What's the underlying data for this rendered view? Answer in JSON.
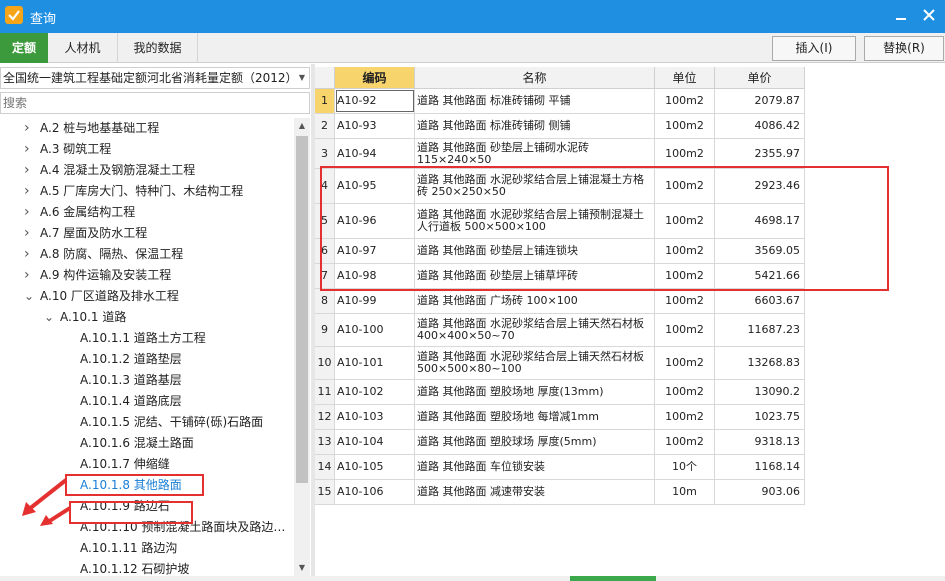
{
  "window": {
    "title": "查询"
  },
  "tabs": [
    {
      "label": "定额"
    },
    {
      "label": "人材机"
    },
    {
      "label": "我的数据"
    }
  ],
  "toolbar": {
    "insert_label": "插入(I)",
    "replace_label": "替换(R)"
  },
  "quota_select": {
    "value": "全国统一建筑工程基础定额河北省消耗量定额（2012）"
  },
  "search": {
    "placeholder": "搜索"
  },
  "tree": [
    {
      "label": "A.2 桩与地基基础工程",
      "expanded": false
    },
    {
      "label": "A.3 砌筑工程",
      "expanded": false
    },
    {
      "label": "A.4 混凝土及钢筋混凝土工程",
      "expanded": false
    },
    {
      "label": "A.5 厂库房大门、特种门、木结构工程",
      "expanded": false
    },
    {
      "label": "A.6 金属结构工程",
      "expanded": false
    },
    {
      "label": "A.7 屋面及防水工程",
      "expanded": false
    },
    {
      "label": "A.8 防腐、隔热、保温工程",
      "expanded": false
    },
    {
      "label": "A.9 构件运输及安装工程",
      "expanded": false
    },
    {
      "label": "A.10 厂区道路及排水工程",
      "expanded": true
    },
    {
      "label": "A.10.1 道路",
      "expanded": true
    },
    {
      "label": "A.10.1.1 道路土方工程"
    },
    {
      "label": "A.10.1.2 道路垫层"
    },
    {
      "label": "A.10.1.3 道路基层"
    },
    {
      "label": "A.10.1.4 道路底层"
    },
    {
      "label": "A.10.1.5 泥结、干铺碎(砾)石路面"
    },
    {
      "label": "A.10.1.6 混凝土路面"
    },
    {
      "label": "A.10.1.7 伸缩缝"
    },
    {
      "label": "A.10.1.8 其他路面",
      "selected": true
    },
    {
      "label": "A.10.1.9 路边石"
    },
    {
      "label": "A.10.1.10 预制混凝土路面块及路边…"
    },
    {
      "label": "A.10.1.11 路边沟"
    },
    {
      "label": "A.10.1.12 石砌护坡"
    }
  ],
  "table": {
    "headers": {
      "code": "编码",
      "name": "名称",
      "unit": "单位",
      "price": "单价"
    },
    "rows": [
      {
        "idx": "1",
        "code": "A10-92",
        "name": "道路 其他路面 标准砖铺砌 平铺",
        "unit": "100m2",
        "price": "2079.87"
      },
      {
        "idx": "2",
        "code": "A10-93",
        "name": "道路 其他路面 标准砖铺砌 侧铺",
        "unit": "100m2",
        "price": "4086.42"
      },
      {
        "idx": "3",
        "code": "A10-94",
        "name": "道路 其他路面 砂垫层上铺砌水泥砖115×240×50",
        "unit": "100m2",
        "price": "2355.97"
      },
      {
        "idx": "4",
        "code": "A10-95",
        "name": "道路 其他路面 水泥砂浆结合层上铺混凝土方格砖 250×250×50",
        "unit": "100m2",
        "price": "2923.46"
      },
      {
        "idx": "5",
        "code": "A10-96",
        "name": "道路 其他路面 水泥砂浆结合层上铺预制混凝土人行道板 500×500×100",
        "unit": "100m2",
        "price": "4698.17"
      },
      {
        "idx": "6",
        "code": "A10-97",
        "name": "道路 其他路面 砂垫层上铺连锁块",
        "unit": "100m2",
        "price": "3569.05"
      },
      {
        "idx": "7",
        "code": "A10-98",
        "name": "道路 其他路面 砂垫层上铺草坪砖",
        "unit": "100m2",
        "price": "5421.66"
      },
      {
        "idx": "8",
        "code": "A10-99",
        "name": "道路 其他路面 广场砖 100×100",
        "unit": "100m2",
        "price": "6603.67"
      },
      {
        "idx": "9",
        "code": "A10-100",
        "name": "道路 其他路面 水泥砂浆结合层上铺天然石材板 400×400×50~70",
        "unit": "100m2",
        "price": "11687.23"
      },
      {
        "idx": "10",
        "code": "A10-101",
        "name": "道路 其他路面 水泥砂浆结合层上铺天然石材板 500×500×80~100",
        "unit": "100m2",
        "price": "13268.83"
      },
      {
        "idx": "11",
        "code": "A10-102",
        "name": "道路 其他路面 塑胶场地 厚度(13mm)",
        "unit": "100m2",
        "price": "13090.2"
      },
      {
        "idx": "12",
        "code": "A10-103",
        "name": "道路 其他路面 塑胶场地 每增减1mm",
        "unit": "100m2",
        "price": "1023.75"
      },
      {
        "idx": "13",
        "code": "A10-104",
        "name": "道路 其他路面 塑胶球场 厚度(5mm)",
        "unit": "100m2",
        "price": "9318.13"
      },
      {
        "idx": "14",
        "code": "A10-105",
        "name": "道路 其他路面 车位锁安装",
        "unit": "10个",
        "price": "1168.14"
      },
      {
        "idx": "15",
        "code": "A10-106",
        "name": "道路 其他路面 减速带安装",
        "unit": "10m",
        "price": "903.06"
      }
    ]
  },
  "colors": {
    "titlebar": "#1f8fe2",
    "active_tab": "#3c9a3c",
    "selected_text": "#1a7fd6",
    "highlight": "#f8d46c",
    "annotation": "#e53030"
  }
}
